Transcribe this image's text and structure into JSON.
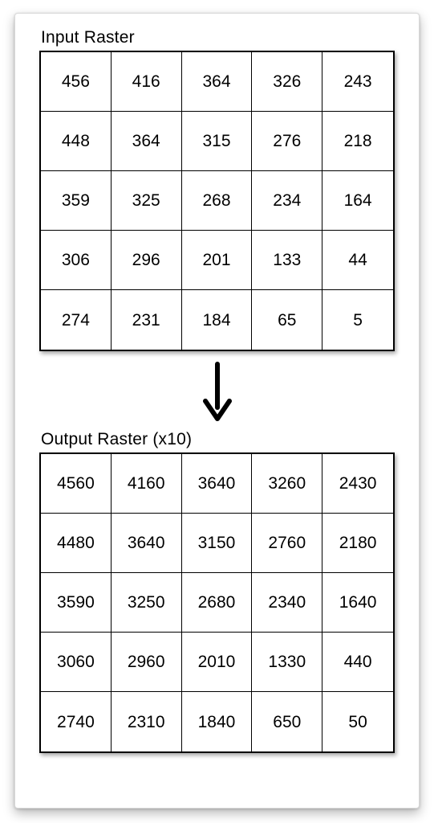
{
  "input_title": "Input Raster",
  "output_title": "Output Raster (x10)",
  "chart_data": [
    {
      "type": "table",
      "title": "Input Raster",
      "rows": 5,
      "cols": 5,
      "values": [
        [
          456,
          416,
          364,
          326,
          243
        ],
        [
          448,
          364,
          315,
          276,
          218
        ],
        [
          359,
          325,
          268,
          234,
          164
        ],
        [
          306,
          296,
          201,
          133,
          44
        ],
        [
          274,
          231,
          184,
          65,
          5
        ]
      ]
    },
    {
      "type": "table",
      "title": "Output Raster (x10)",
      "rows": 5,
      "cols": 5,
      "values": [
        [
          4560,
          4160,
          3640,
          3260,
          2430
        ],
        [
          4480,
          3640,
          3150,
          2760,
          2180
        ],
        [
          3590,
          3250,
          2680,
          2340,
          1640
        ],
        [
          3060,
          2960,
          2010,
          1330,
          440
        ],
        [
          2740,
          2310,
          1840,
          650,
          50
        ]
      ]
    }
  ]
}
